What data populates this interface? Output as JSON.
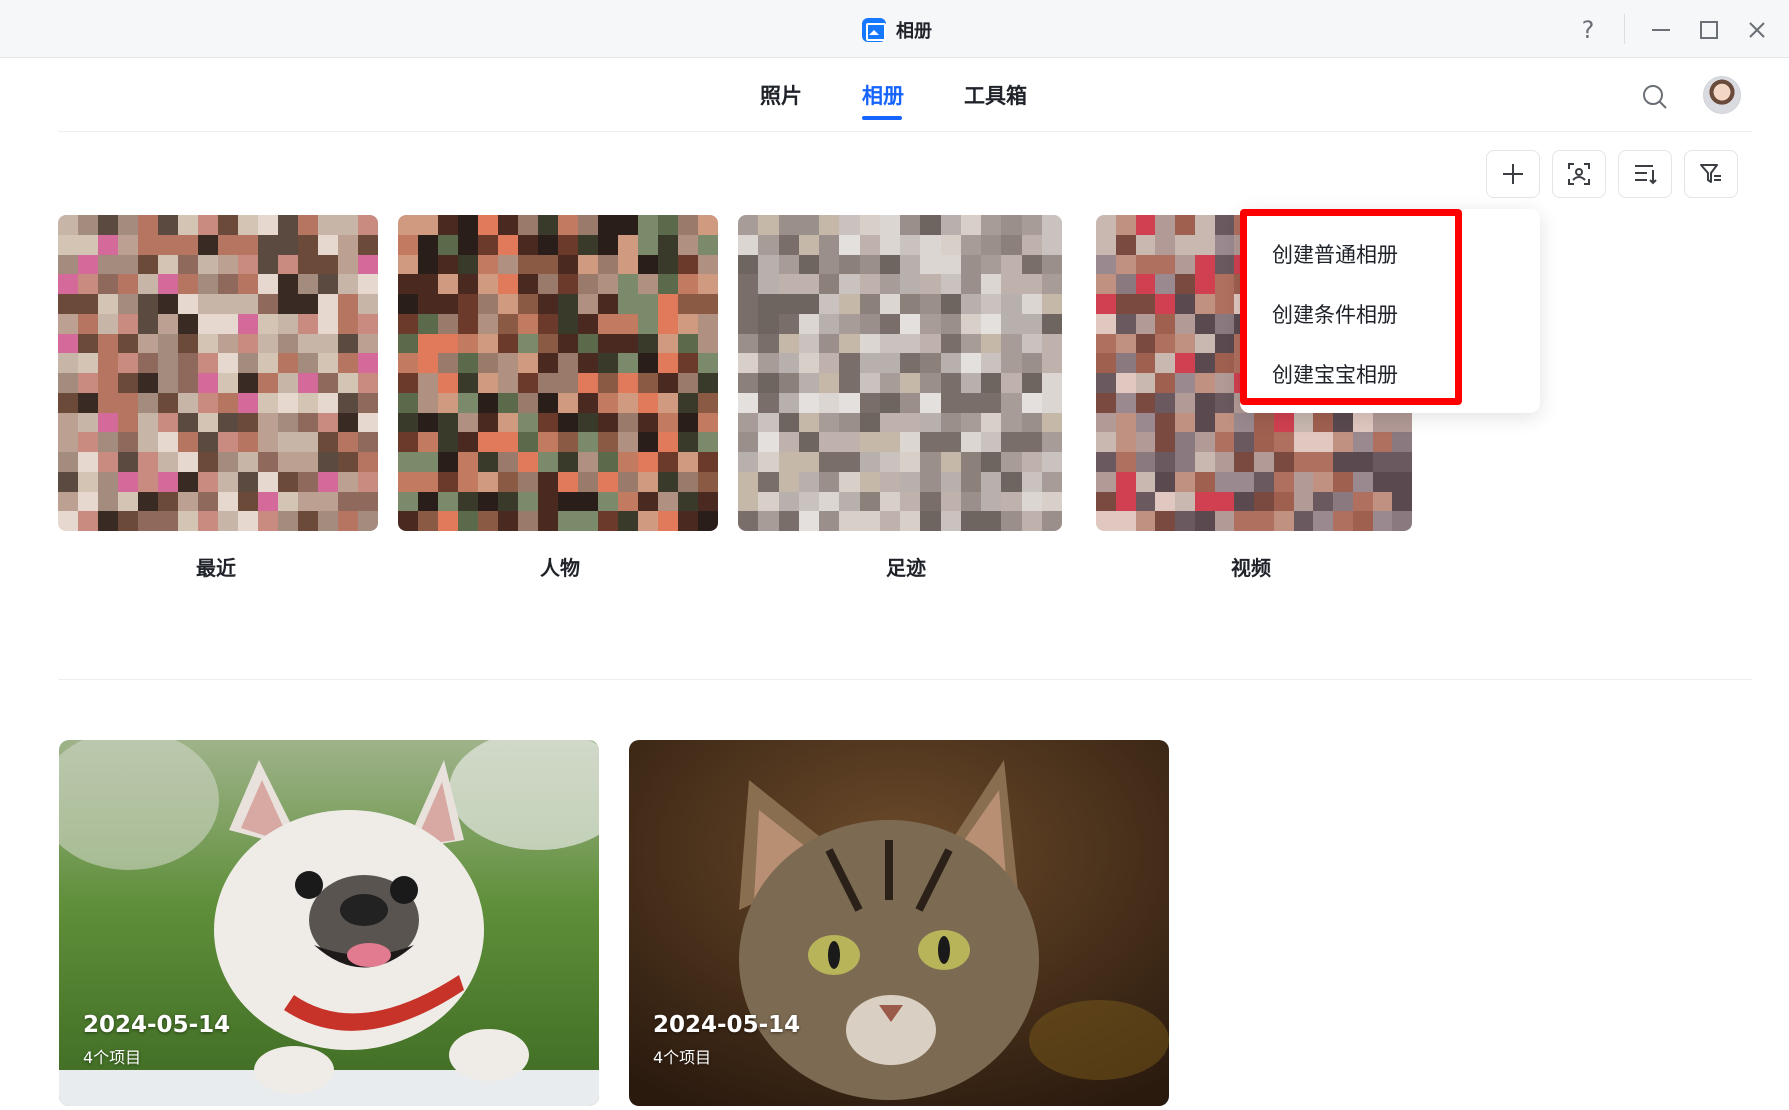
{
  "window": {
    "title": "相册",
    "help_glyph": "?",
    "minimize_glyph": "—",
    "close_glyph": "✕"
  },
  "nav": {
    "tabs": [
      {
        "label": "照片",
        "active": false
      },
      {
        "label": "相册",
        "active": true
      },
      {
        "label": "工具箱",
        "active": false
      }
    ]
  },
  "toolbar": {
    "icons": [
      "plus-icon",
      "face-scan-icon",
      "sort-icon",
      "filter-icon"
    ]
  },
  "smart_albums": [
    {
      "label": "最近"
    },
    {
      "label": "人物"
    },
    {
      "label": "足迹"
    },
    {
      "label": "视频"
    }
  ],
  "menu": {
    "items": [
      "创建普通相册",
      "创建条件相册",
      "创建宝宝相册"
    ]
  },
  "albums": [
    {
      "date": "2024-05-14",
      "count": "4个项目",
      "subject": "dog"
    },
    {
      "date": "2024-05-14",
      "count": "4个项目",
      "subject": "cat"
    }
  ],
  "colors": {
    "accent": "#1664ff",
    "highlight": "#ff0000"
  }
}
